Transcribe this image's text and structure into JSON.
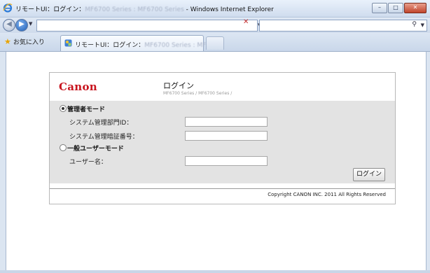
{
  "window": {
    "title_prefix": "リモートUI：ログイン：",
    "title_blurred": "MF6700 Series : MF6700 Series",
    "title_suffix": " - Windows Internet Explorer",
    "minimize": "–",
    "maximize": "□",
    "close": "✕"
  },
  "nav": {
    "back_glyph": "◀",
    "forward_glyph": "▶",
    "dropdown_glyph": "▼",
    "refresh_glyph": "↻",
    "stop_glyph": "✕",
    "search_glyph": "⚲",
    "address_value": "",
    "search_value": ""
  },
  "favorites": {
    "label": "お気に入り"
  },
  "tab": {
    "prefix": "リモートUI：ログイン：",
    "blurred": "MF6700 Series : MF",
    "suffix": " ..."
  },
  "login": {
    "logo": "Canon",
    "title": "ログイン",
    "model": "MF6700 Series / MF6700 Series /",
    "admin_mode_label": "管理者モード",
    "dept_id_label": "システム管理部門ID：",
    "pin_label": "システム管理暗証番号：",
    "general_mode_label": "一般ユーザーモード",
    "username_label": "ユーザー名：",
    "dept_id_value": "",
    "pin_value": "",
    "username_value": "",
    "admin_mode_selected": true,
    "login_button": "ログイン",
    "copyright": "Copyright CANON INC. 2011 All Rights Reserved"
  },
  "colors": {
    "canon_red": "#c8141e",
    "form_bg": "#e3e3e3",
    "chrome_blue": "#dbe5f1"
  }
}
